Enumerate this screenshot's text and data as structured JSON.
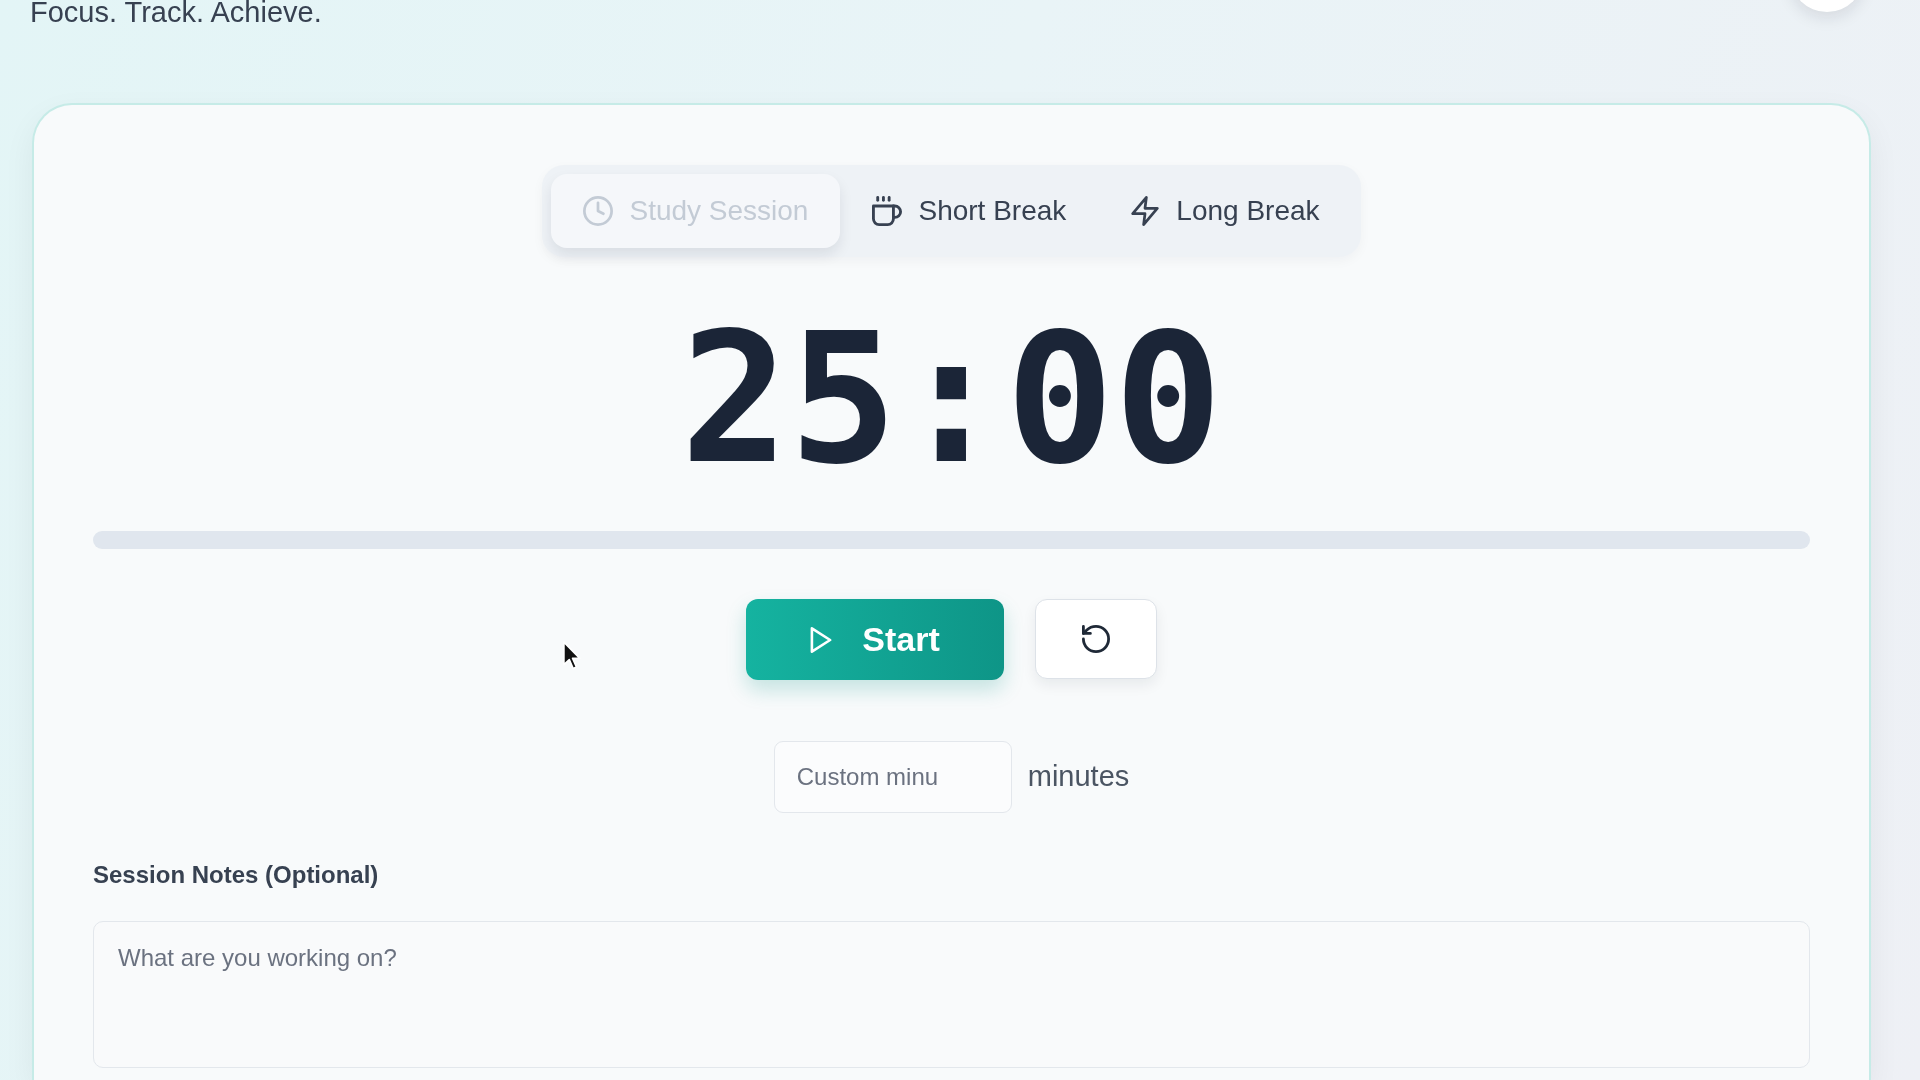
{
  "header": {
    "tagline": "Focus. Track. Achieve."
  },
  "timer_card": {
    "tabs": [
      {
        "kind": "study",
        "label": "Study Session",
        "selected": true
      },
      {
        "kind": "short",
        "label": "Short Break",
        "selected": false
      },
      {
        "kind": "long",
        "label": "Long Break",
        "selected": false
      }
    ],
    "time": "25:00",
    "progress": {
      "level": 0
    },
    "buttons": [
      {
        "kind": "start",
        "label": "Start"
      },
      {
        "kind": "reset"
      }
    ],
    "custom_duration": {
      "placeholder": "Custom minu",
      "unit": "minutes"
    },
    "notes": {
      "label": "Session Notes (Optional)",
      "placeholder": "What are you working on?"
    }
  }
}
